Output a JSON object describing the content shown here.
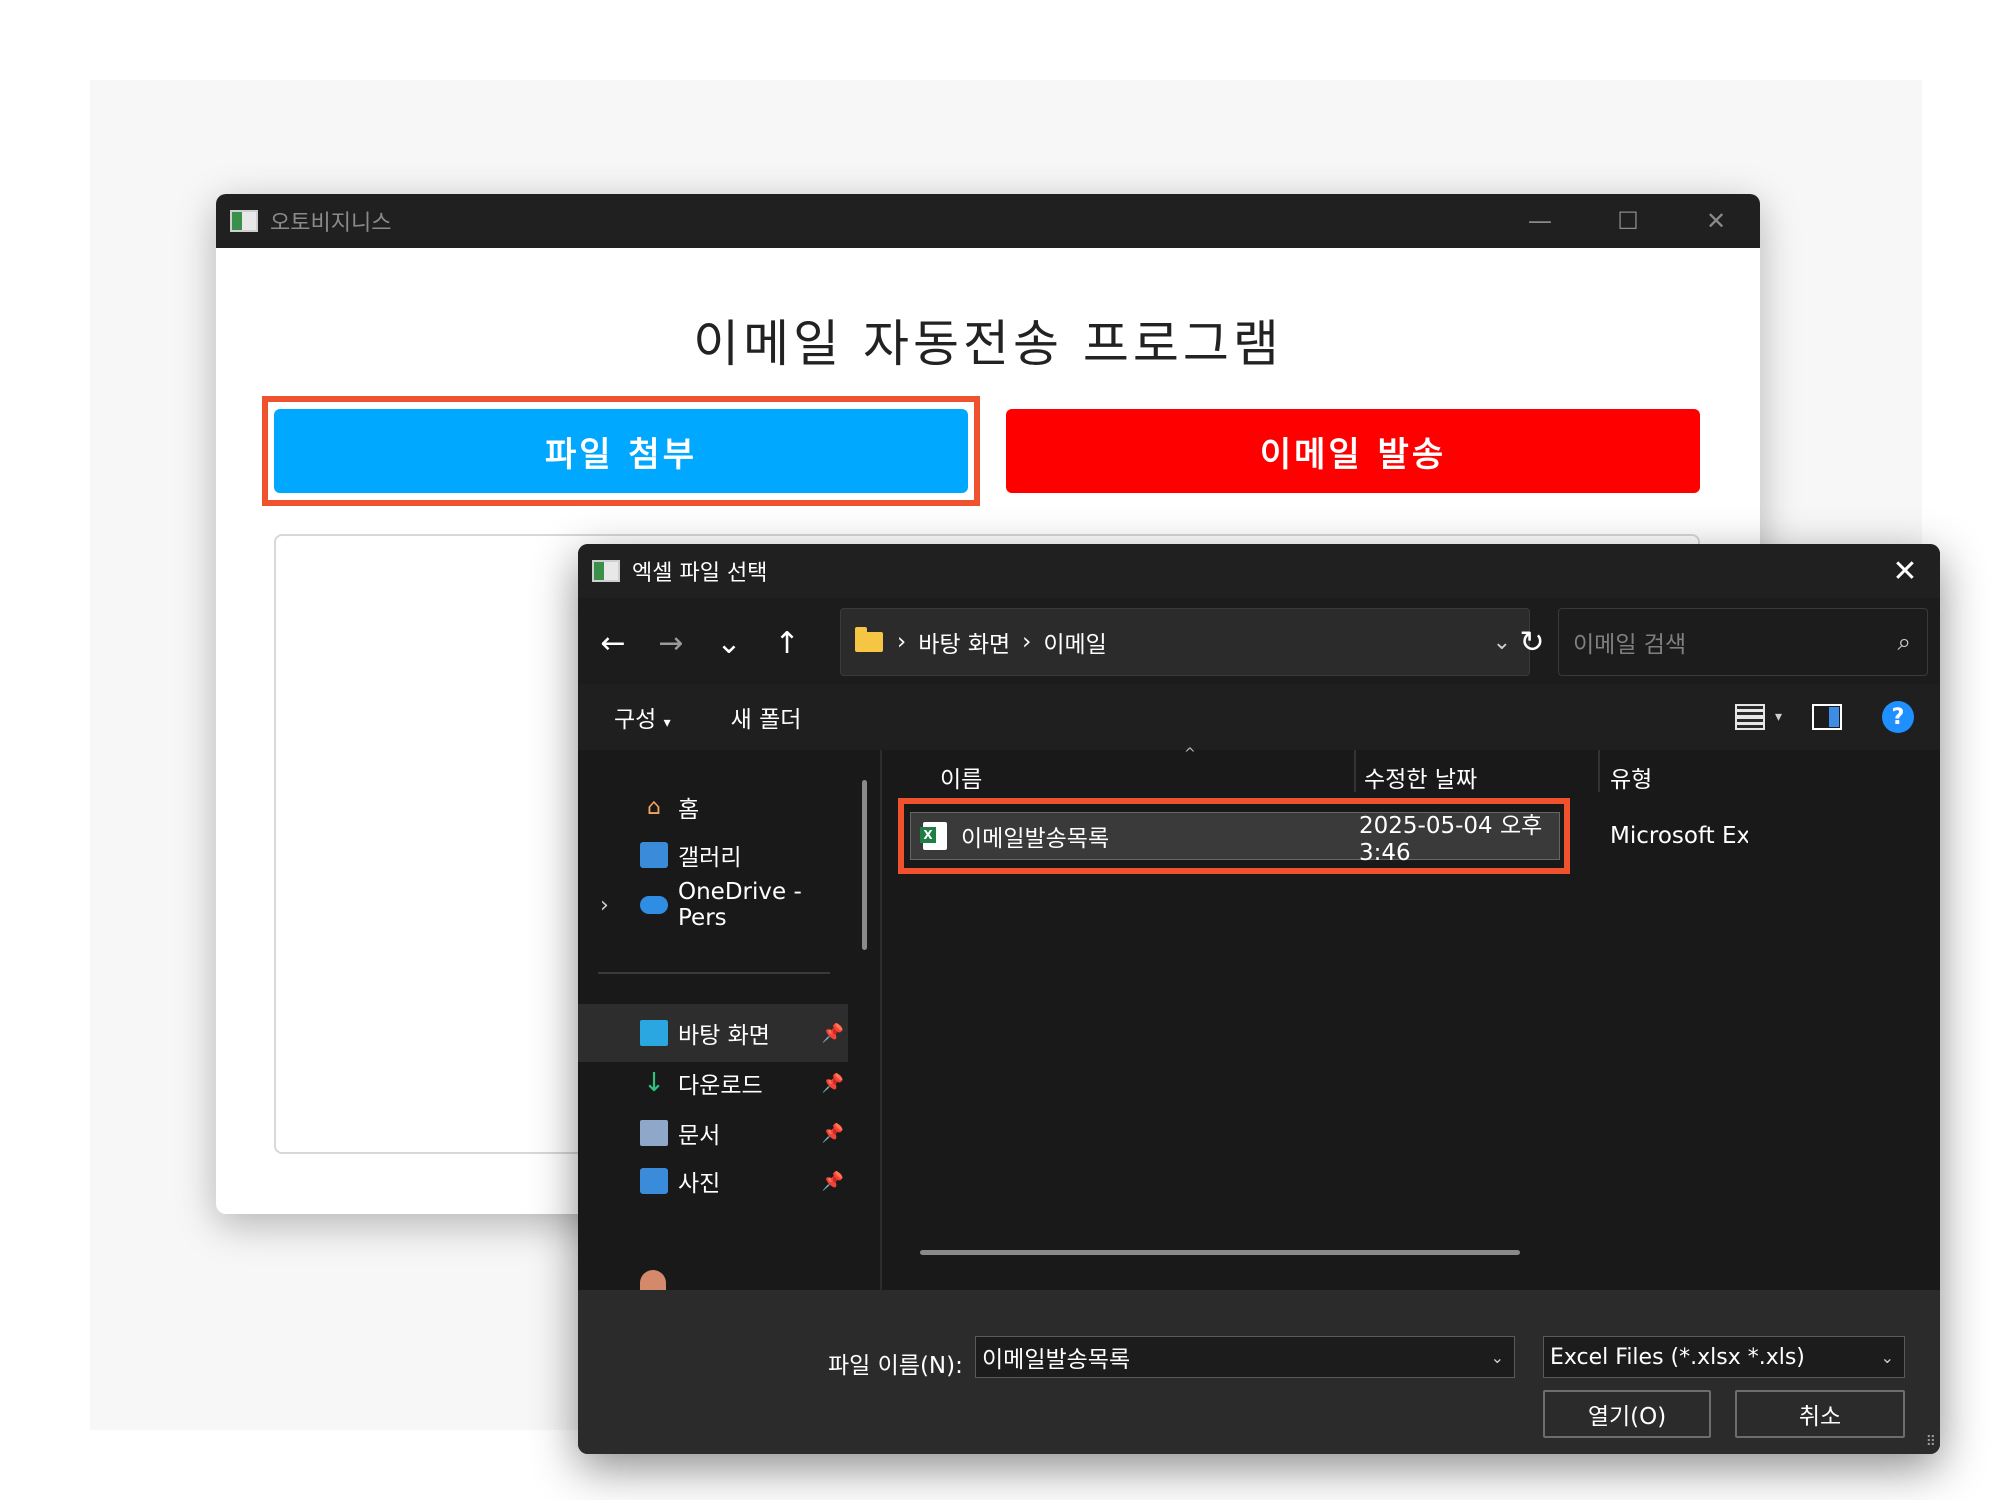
{
  "main_window": {
    "title": "오토비지니스",
    "controls": {
      "minimize": "—",
      "maximize": "☐",
      "close": "✕"
    },
    "heading": "이메일 자동전송 프로그램",
    "attach_button": "파일 첨부",
    "send_button": "이메일 발송"
  },
  "dialog": {
    "title": "엑셀 파일 선택",
    "close": "✕",
    "nav": {
      "back": "←",
      "forward": "→",
      "recent": "⌄",
      "up": "↑"
    },
    "address": {
      "crumbs": [
        "바탕 화면",
        "이메일"
      ],
      "separator": "›",
      "chevron": "⌄"
    },
    "refresh": "↻",
    "search": {
      "placeholder": "이메일 검색",
      "icon": "⌕"
    },
    "toolbar": {
      "organize": "구성",
      "organize_caret": "▾",
      "new_folder": "새 폴더",
      "view_caret": "▾",
      "help": "?"
    },
    "sidebar": {
      "expander": "›",
      "pin": "📌",
      "items": [
        {
          "label": "홈",
          "icon": "home-icon"
        },
        {
          "label": "갤러리",
          "icon": "gallery-icon"
        },
        {
          "label": "OneDrive - Pers",
          "icon": "onedrive-cloud-icon"
        },
        {
          "label": "바탕 화면",
          "icon": "desktop-icon",
          "pinned": true,
          "selected": true
        },
        {
          "label": "다운로드",
          "icon": "download-icon",
          "pinned": true
        },
        {
          "label": "문서",
          "icon": "documents-icon",
          "pinned": true
        },
        {
          "label": "사진",
          "icon": "pictures-icon",
          "pinned": true
        }
      ]
    },
    "columns": {
      "name": "이름",
      "modified": "수정한 날짜",
      "type": "유형",
      "sort_caret": "^"
    },
    "files": [
      {
        "name": "이메일발송목록",
        "modified": "2025-05-04 오후 3:46",
        "type": "Microsoft Exc"
      }
    ],
    "footer": {
      "filename_label": "파일 이름(N):",
      "filename_value": "이메일발송목록",
      "filetype_value": "Excel Files (*.xlsx *.xls)",
      "caret": "⌄",
      "open_button": "열기(O)",
      "cancel_button": "취소",
      "grip": "⠿"
    }
  },
  "colors": {
    "attach": "#00a8ff",
    "send": "#ff0000",
    "highlight": "#f0522e",
    "dialog_bg": "#1c1c1c"
  }
}
